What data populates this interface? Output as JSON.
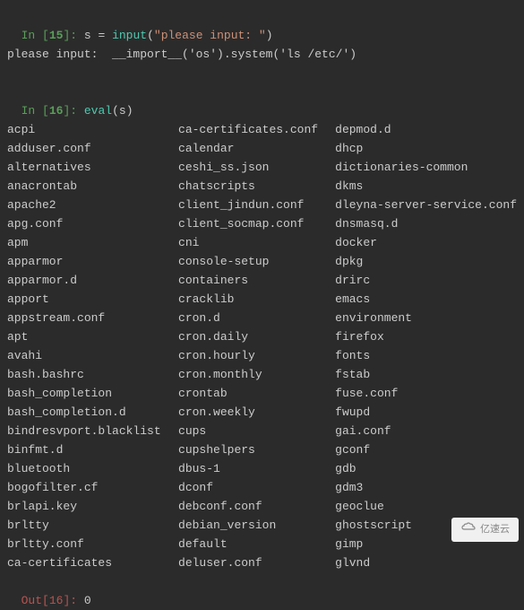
{
  "cell_in_1": {
    "prompt_prefix": "In [",
    "prompt_num": "15",
    "prompt_suffix": "]: ",
    "var": "s",
    "assign": " = ",
    "func": "input",
    "open": "(",
    "arg": "\"please input: \"",
    "close": ")"
  },
  "stdin_echo": "please input:  __import__('os').system('ls /etc/')",
  "cell_in_2": {
    "prompt_prefix": "In [",
    "prompt_num": "16",
    "prompt_suffix": "]: ",
    "func": "eval",
    "open": "(",
    "arg": "s",
    "close": ")"
  },
  "listing": {
    "col1": [
      "acpi",
      "adduser.conf",
      "alternatives",
      "anacrontab",
      "apache2",
      "apg.conf",
      "apm",
      "apparmor",
      "apparmor.d",
      "apport",
      "appstream.conf",
      "apt",
      "avahi",
      "bash.bashrc",
      "bash_completion",
      "bash_completion.d",
      "bindresvport.blacklist",
      "binfmt.d",
      "bluetooth",
      "bogofilter.cf",
      "brlapi.key",
      "brltty",
      "brltty.conf",
      "ca-certificates"
    ],
    "col2": [
      "ca-certificates.conf",
      "calendar",
      "ceshi_ss.json",
      "chatscripts",
      "client_jindun.conf",
      "client_socmap.conf",
      "cni",
      "console-setup",
      "containers",
      "cracklib",
      "cron.d",
      "cron.daily",
      "cron.hourly",
      "cron.monthly",
      "crontab",
      "cron.weekly",
      "cups",
      "cupshelpers",
      "dbus-1",
      "dconf",
      "debconf.conf",
      "debian_version",
      "default",
      "deluser.conf"
    ],
    "col3": [
      "depmod.d",
      "dhcp",
      "dictionaries-common",
      "dkms",
      "dleyna-server-service.conf",
      "dnsmasq.d",
      "docker",
      "dpkg",
      "drirc",
      "emacs",
      "environment",
      "firefox",
      "fonts",
      "fstab",
      "fuse.conf",
      "fwupd",
      "gai.conf",
      "gconf",
      "gdb",
      "gdm3",
      "geoclue",
      "ghostscript",
      "gimp",
      "glvnd"
    ]
  },
  "cell_out": {
    "prompt_prefix": "Out[",
    "prompt_num": "16",
    "prompt_suffix": "]: ",
    "result": "0"
  },
  "watermark": {
    "text": "亿速云"
  }
}
